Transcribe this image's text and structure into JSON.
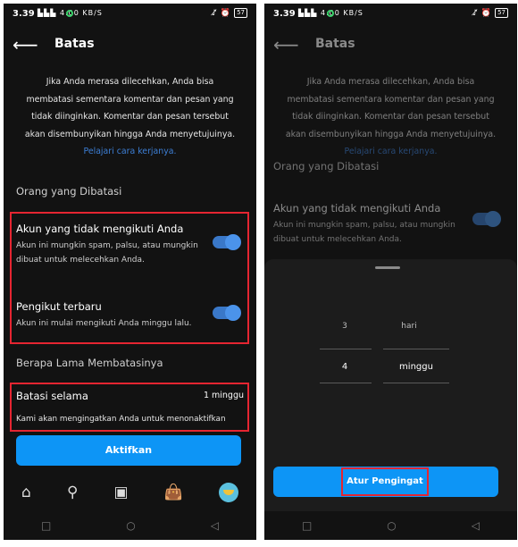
{
  "status": {
    "time": "3.39",
    "signal": "▙▙▙ 4.00 KB/S",
    "battery": "57"
  },
  "header": {
    "title": "Batas",
    "back_icon": "arrow-left-icon"
  },
  "description": {
    "text": "Jika Anda merasa dilecehkan, Anda bisa membatasi sementara komentar dan pesan yang tidak diinginkan. Komentar dan pesan tersebut akan disembunyikan hingga Anda menyetujuinya.",
    "link": "Pelajari cara kerjanya."
  },
  "restricted": {
    "section_label": "Orang yang Dibatasi",
    "items": [
      {
        "title": "Akun yang tidak mengikuti Anda",
        "subtitle": "Akun ini mungkin spam, palsu, atau mungkin dibuat untuk melecehkan Anda.",
        "enabled": true
      },
      {
        "title": "Pengikut terbaru",
        "subtitle": "Akun ini mulai mengikuti Anda minggu lalu.",
        "enabled": true
      }
    ]
  },
  "duration": {
    "section_label": "Berapa Lama Membatasinya",
    "limit_label": "Batasi selama",
    "limit_value": "1 minggu",
    "reminder_text": "Kami akan mengingatkan Anda untuk menonaktifkan"
  },
  "activate_button": "Aktifkan",
  "tabbar": [
    "home-icon",
    "search-icon",
    "reels-icon",
    "shop-icon",
    "profile-avatar"
  ],
  "picker": {
    "rows": [
      {
        "number": "3",
        "unit": "hari",
        "selected": false
      },
      {
        "number": "4",
        "unit": "minggu",
        "selected": true
      }
    ],
    "set_reminder_button": "Atur Pengingat"
  },
  "right_partial_label": "Orang yang Dibatasi",
  "colors": {
    "background": "#121212",
    "accent": "#0d95f6",
    "highlight": "#e52531",
    "toggle": "#3a78c8"
  }
}
